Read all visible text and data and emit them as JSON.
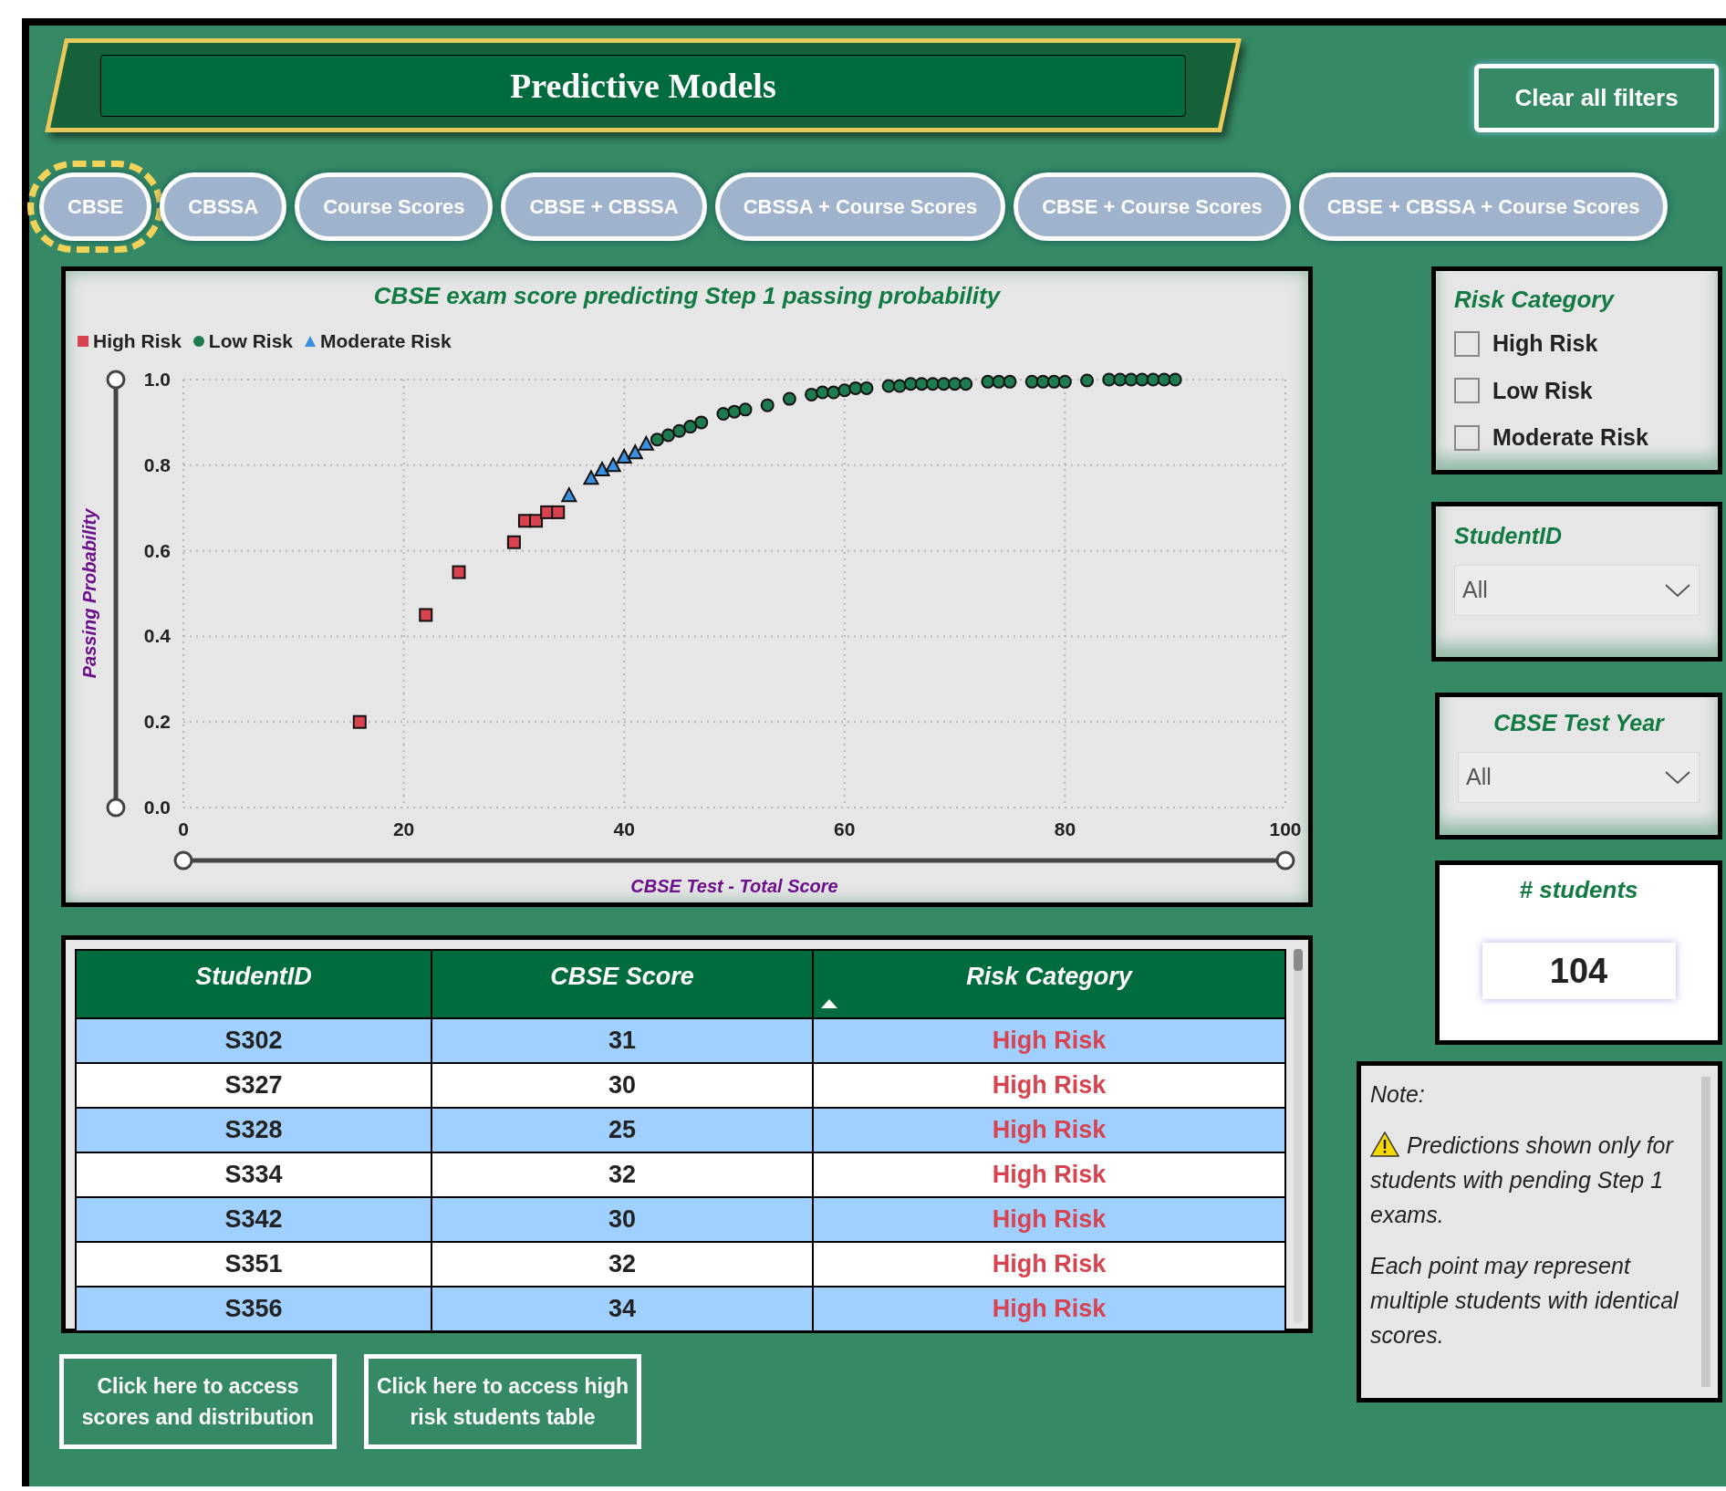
{
  "header": {
    "title": "Predictive Models",
    "clear_button": "Clear all filters"
  },
  "tabs": [
    {
      "label": "CBSE",
      "selected": true
    },
    {
      "label": "CBSSA",
      "selected": false
    },
    {
      "label": "Course Scores",
      "selected": false
    },
    {
      "label": "CBSE + CBSSA",
      "selected": false
    },
    {
      "label": "CBSSA + Course Scores",
      "selected": false
    },
    {
      "label": "CBSE + Course Scores",
      "selected": false
    },
    {
      "label": "CBSE + CBSSA + Course Scores",
      "selected": false
    }
  ],
  "chart": {
    "chart_data": {
      "type": "scatter",
      "grid": true,
      "legend": true,
      "title": "CBSE exam score predicting Step 1 passing probability",
      "xlabel": "CBSE Test - Total Score",
      "ylabel": "Passing Probability",
      "xlim": [
        0,
        100
      ],
      "ylim": [
        0,
        1
      ],
      "xticks": [
        0,
        20,
        40,
        60,
        80,
        100
      ],
      "yticks": [
        {
          "value": 0,
          "label": "0.0"
        },
        {
          "value": 0.2,
          "label": "0.2"
        },
        {
          "value": 0.4,
          "label": "0.4"
        },
        {
          "value": 0.6,
          "label": "0.6"
        },
        {
          "value": 0.8,
          "label": "0.8"
        },
        {
          "value": 1,
          "label": "1.0"
        }
      ],
      "series": [
        {
          "name": "High Risk",
          "color": "#d9434f",
          "x": [
            16,
            22,
            25,
            30,
            31,
            32,
            33,
            34
          ],
          "values": [
            0.2,
            0.45,
            0.55,
            0.62,
            0.67,
            0.67,
            0.69,
            0.69
          ]
        },
        {
          "name": "Low Risk",
          "color": "#1e7a4f",
          "x": [
            43,
            44,
            45,
            46,
            47,
            49,
            50,
            51,
            53,
            55,
            57,
            58,
            59,
            60,
            61,
            62,
            64,
            65,
            66,
            67,
            68,
            69,
            70,
            71,
            73,
            74,
            75,
            77,
            78,
            79,
            80,
            82,
            84,
            85,
            86,
            87,
            88,
            89,
            90
          ],
          "values": [
            0.86,
            0.87,
            0.88,
            0.89,
            0.9,
            0.92,
            0.925,
            0.93,
            0.94,
            0.955,
            0.965,
            0.97,
            0.97,
            0.975,
            0.98,
            0.98,
            0.985,
            0.985,
            0.99,
            0.99,
            0.99,
            0.99,
            0.99,
            0.99,
            0.995,
            0.995,
            0.995,
            0.995,
            0.995,
            0.995,
            0.995,
            0.998,
            1,
            1,
            1,
            1,
            1,
            1,
            1
          ]
        },
        {
          "name": "Moderate Risk",
          "color": "#3b8fe0",
          "x": [
            35,
            37,
            38,
            39,
            40,
            41,
            42
          ],
          "values": [
            0.73,
            0.77,
            0.79,
            0.8,
            0.82,
            0.83,
            0.85
          ]
        }
      ]
    }
  },
  "table": {
    "columns": [
      {
        "label": "StudentID",
        "sorted": false
      },
      {
        "label": "CBSE Score",
        "sorted": false
      },
      {
        "label": "Risk Category",
        "sorted": true
      }
    ],
    "rows": [
      [
        "S302",
        "31",
        "High Risk"
      ],
      [
        "S327",
        "30",
        "High Risk"
      ],
      [
        "S328",
        "25",
        "High Risk"
      ],
      [
        "S334",
        "32",
        "High Risk"
      ],
      [
        "S342",
        "30",
        "High Risk"
      ],
      [
        "S351",
        "32",
        "High Risk"
      ],
      [
        "S356",
        "34",
        "High Risk"
      ]
    ]
  },
  "links": [
    "Click here to access scores and distribution",
    "Click here to access high risk students table"
  ],
  "filters": {
    "risk_category": {
      "title": "Risk Category",
      "options": [
        {
          "label": "High Risk",
          "checked": false
        },
        {
          "label": "Low Risk",
          "checked": false
        },
        {
          "label": "Moderate Risk",
          "checked": false
        }
      ]
    },
    "student_id": {
      "title": "StudentID",
      "value": "All"
    },
    "test_year": {
      "title": "CBSE Test Year",
      "value": "All"
    }
  },
  "count": {
    "title": "# students",
    "value": "104"
  },
  "note": {
    "title": "Note:",
    "paragraphs": [
      {
        "text": "Predictions shown only for students with pending Step 1 exams.",
        "warning": true
      },
      {
        "text": "Each point may represent multiple students with identical scores.",
        "warning": false
      }
    ]
  }
}
